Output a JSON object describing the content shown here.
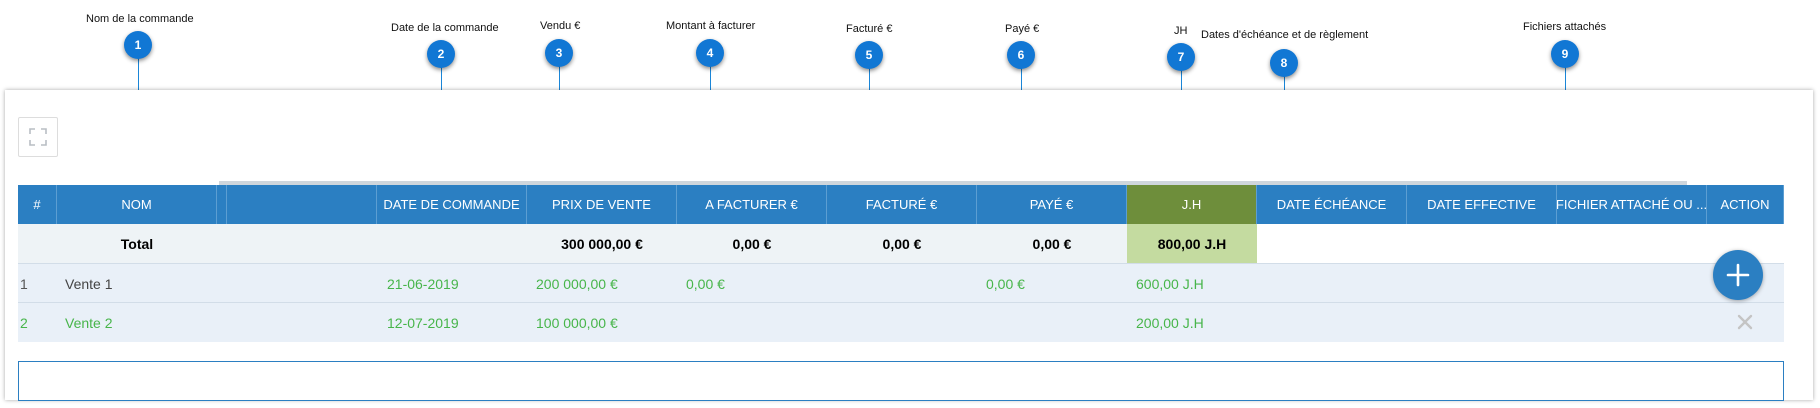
{
  "callouts": [
    {
      "num": "1",
      "label": "Nom de la commande"
    },
    {
      "num": "2",
      "label": "Date de la commande"
    },
    {
      "num": "3",
      "label": "Vendu €"
    },
    {
      "num": "4",
      "label": "Montant à facturer"
    },
    {
      "num": "5",
      "label": "Facturé €"
    },
    {
      "num": "6",
      "label": "Payé €"
    },
    {
      "num": "7",
      "label": "JH"
    },
    {
      "num": "8",
      "label": "Dates d'échéance et de règlement"
    },
    {
      "num": "9",
      "label": "Fichiers attachés"
    }
  ],
  "table": {
    "headers": {
      "index": "#",
      "nom": "NOM",
      "date_commande": "DATE DE COMMANDE",
      "prix_vente": "PRIX DE VENTE",
      "a_facturer": "A FACTURER €",
      "facture": "FACTURÉ €",
      "paye": "PAYÉ €",
      "jh": "J.H",
      "date_echeance": "DATE ÉCHÉANCE",
      "date_effective": "DATE EFFECTIVE",
      "fichier": "FICHIER ATTACHÉ OU ...",
      "action": "ACTION"
    },
    "total": {
      "label": "Total",
      "prix_vente": "300 000,00 €",
      "a_facturer": "0,00 €",
      "facture": "0,00 €",
      "paye": "0,00 €",
      "jh": "800,00 J.H"
    },
    "rows": [
      {
        "index": "1",
        "nom": "Vente 1",
        "date_commande": "21-06-2019",
        "prix_vente": "200 000,00 €",
        "a_facturer": "0,00 €",
        "paye": "0,00 €",
        "jh": "600,00  J.H"
      },
      {
        "index": "2",
        "nom": "Vente 2",
        "date_commande": "12-07-2019",
        "prix_vente": "100 000,00 €",
        "a_facturer": "",
        "paye": "",
        "jh": "200,00  J.H"
      }
    ]
  },
  "icons": {
    "expand": "expand-icon",
    "delete": "close-icon",
    "add": "plus-icon"
  },
  "colors": {
    "header_bg": "#2b7fc2",
    "jh_header_bg": "#6e8e3b",
    "jh_total_bg": "#c4dba0",
    "badge": "#1177d4",
    "data_green": "#47b54a"
  }
}
